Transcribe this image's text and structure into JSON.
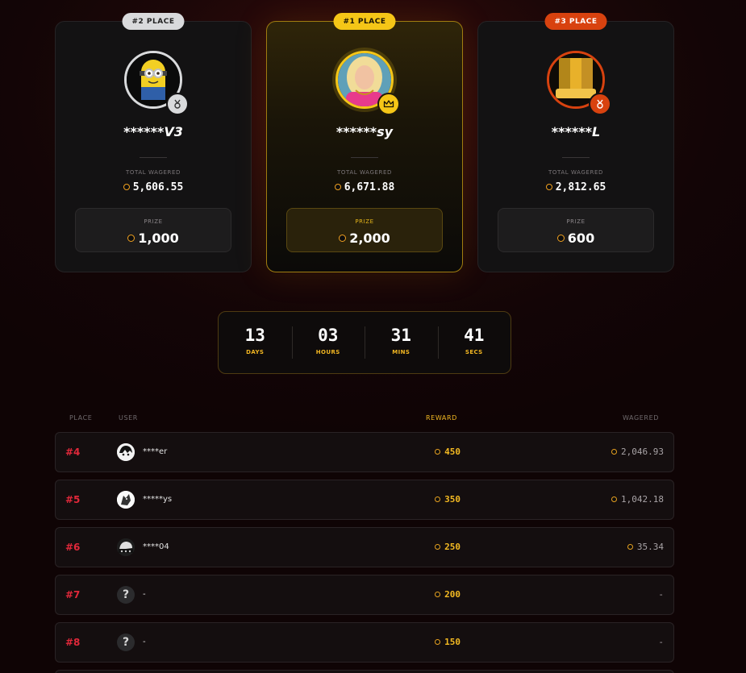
{
  "podium": {
    "second": {
      "place_label": "#2 PLACE",
      "username": "******V3",
      "total_wagered_label": "TOTAL WAGERED",
      "total_wagered": "5,606.55",
      "prize_label": "PRIZE",
      "prize": "1,000",
      "color": "#d9dadc"
    },
    "first": {
      "place_label": "#1 PLACE",
      "username": "******sy",
      "total_wagered_label": "TOTAL WAGERED",
      "total_wagered": "6,671.88",
      "prize_label": "PRIZE",
      "prize": "2,000",
      "color": "#f5c617"
    },
    "third": {
      "place_label": "#3 PLACE",
      "username": "******L",
      "total_wagered_label": "TOTAL WAGERED",
      "total_wagered": "2,812.65",
      "prize_label": "PRIZE",
      "prize": "600",
      "color": "#d8420f"
    }
  },
  "countdown": {
    "days": "13",
    "days_label": "DAYS",
    "hours": "03",
    "hours_label": "HOURS",
    "mins": "31",
    "mins_label": "MINS",
    "secs": "41",
    "secs_label": "SECS"
  },
  "table": {
    "headers": {
      "place": "PLACE",
      "user": "USER",
      "reward": "REWARD",
      "wagered": "WAGERED"
    },
    "rows": [
      {
        "place": "#4",
        "user": "****er",
        "reward": "450",
        "wagered": "2,046.93",
        "avatar": "anime-avatar"
      },
      {
        "place": "#5",
        "user": "*****ys",
        "reward": "350",
        "wagered": "1,042.18",
        "avatar": "wolf-avatar"
      },
      {
        "place": "#6",
        "user": "****04",
        "reward": "250",
        "wagered": "35.34",
        "avatar": "mask-avatar"
      },
      {
        "place": "#7",
        "user": "-",
        "reward": "200",
        "wagered": "-",
        "avatar": "question-icon"
      },
      {
        "place": "#8",
        "user": "-",
        "reward": "150",
        "wagered": "-",
        "avatar": "question-icon"
      }
    ]
  },
  "colors": {
    "accent_gold": "#f3b922",
    "place_red": "#e0283a"
  }
}
